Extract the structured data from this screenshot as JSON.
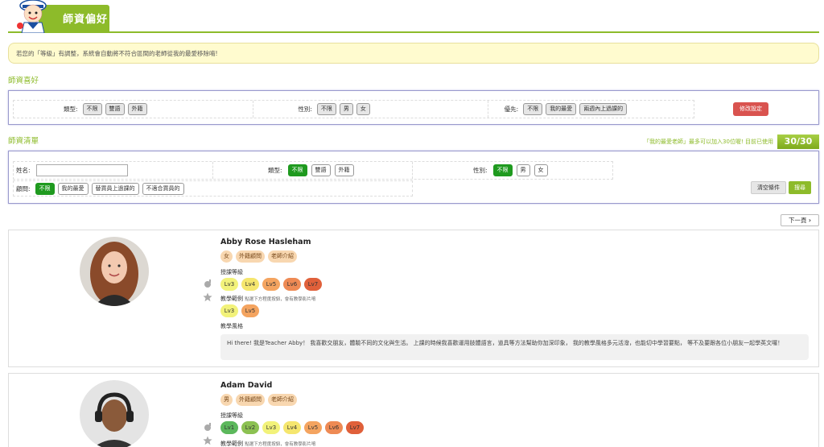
{
  "header": {
    "title": "師資偏好"
  },
  "notice": {
    "text": "若您的「等級」有調整，系統會自動將不符合區間的老師從我的最愛移除唷!"
  },
  "preferences": {
    "section_title": "師資喜好",
    "type": {
      "label": "類型:",
      "options": [
        "不限",
        "雙語",
        "外籍"
      ]
    },
    "gender": {
      "label": "性別:",
      "options": [
        "不限",
        "男",
        "女"
      ]
    },
    "priority": {
      "label": "優先:",
      "options": [
        "不限",
        "我的最愛",
        "兩週內上過課的"
      ]
    },
    "edit_button": "修改設定"
  },
  "teacher_list": {
    "section_title": "師資清單",
    "quota_text": "「我的最愛老師」最多可以加入30位喔! 目前已使用",
    "quota_value": "30/30"
  },
  "search": {
    "name_label": "姓名:",
    "name_value": "",
    "type_label": "類型:",
    "type_options": [
      "不限",
      "雙語",
      "外籍"
    ],
    "gender_label": "性別:",
    "gender_options": [
      "不限",
      "男",
      "女"
    ],
    "consultant_label": "顧問:",
    "consultant_options": [
      "不限",
      "我的最愛",
      "替買員上過課的",
      "不適合買員的"
    ],
    "clear_button": "清空條件",
    "search_button": "搜尋"
  },
  "pagination": {
    "next_label": "下一頁"
  },
  "teachers": [
    {
      "name": "Abby Rose Hasleham",
      "tags": [
        "女",
        "外籍顧問",
        "老師介紹"
      ],
      "levels_label": "授課等級",
      "levels": [
        "Lv3",
        "Lv4",
        "Lv5",
        "Lv6",
        "Lv7"
      ],
      "examples_label": "教學範例",
      "examples_hint": "點選下方程度按鈕，會有教學影片唷",
      "examples": [
        "Lv3",
        "Lv5"
      ],
      "style_label": "教學風格",
      "intro": "Hi there! 我是Teacher Abby！ 我喜歡交朋友，體驗不同的文化與生活。 上課的時候我喜歡運用肢體語言，道具等方法幫助你加深印象， 我的教學風格多元活潑，也能切中學習要點， 等不及要跟各位小朋友一起學英文囉！"
    },
    {
      "name": "Adam David",
      "tags": [
        "男",
        "外籍顧問",
        "老師介紹"
      ],
      "levels_label": "授課等級",
      "levels": [
        "Lv1",
        "Lv2",
        "Lv3",
        "Lv4",
        "Lv5",
        "Lv6",
        "Lv7"
      ],
      "examples_label": "教學範例",
      "examples_hint": "點選下方程度按鈕，會有教學影片唷"
    }
  ],
  "level_colors": {
    "Lv1": "#5cb85c",
    "Lv2": "#8cc152",
    "Lv3": "#f2f27a",
    "Lv4": "#f5e66e",
    "Lv5": "#f4a460",
    "Lv6": "#ee8a54",
    "Lv7": "#e0603a"
  }
}
